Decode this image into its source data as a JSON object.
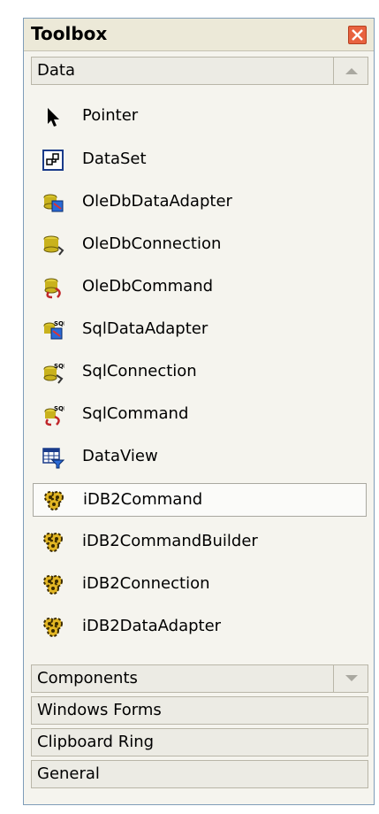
{
  "toolbox": {
    "title": "Toolbox",
    "sections": {
      "data": "Data",
      "components": "Components",
      "windows_forms": "Windows Forms",
      "clipboard_ring": "Clipboard Ring",
      "general": "General"
    },
    "items": [
      {
        "label": "Pointer",
        "icon": "pointer-arrow-icon"
      },
      {
        "label": "DataSet",
        "icon": "dataset-icon"
      },
      {
        "label": "OleDbDataAdapter",
        "icon": "oledb-data-adapter-icon"
      },
      {
        "label": "OleDbConnection",
        "icon": "oledb-connection-icon"
      },
      {
        "label": "OleDbCommand",
        "icon": "oledb-command-icon"
      },
      {
        "label": "SqlDataAdapter",
        "icon": "sql-data-adapter-icon"
      },
      {
        "label": "SqlConnection",
        "icon": "sql-connection-icon"
      },
      {
        "label": "SqlCommand",
        "icon": "sql-command-icon"
      },
      {
        "label": "DataView",
        "icon": "dataview-icon"
      },
      {
        "label": "iDB2Command",
        "icon": "gear-icon",
        "selected": true
      },
      {
        "label": "iDB2CommandBuilder",
        "icon": "gear-icon"
      },
      {
        "label": "iDB2Connection",
        "icon": "gear-icon"
      },
      {
        "label": "iDB2DataAdapter",
        "icon": "gear-icon"
      }
    ]
  }
}
